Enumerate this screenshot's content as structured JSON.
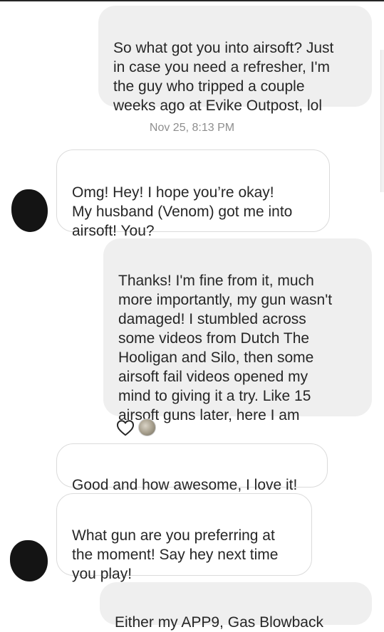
{
  "conversation": {
    "messages": [
      {
        "sender": "me",
        "text": "So what got you into airsoft? Just\nin case you need a refresher, I'm\nthe guy who tripped a couple\nweeks ago at Evike Outpost, lol"
      },
      {
        "sender": "them",
        "text": "Omg! Hey! I hope you’re okay!\nMy husband (Venom) got me into\nairsoft! You?"
      },
      {
        "sender": "me",
        "text": "Thanks! I'm fine from it, much\nmore importantly, my gun wasn't\ndamaged! I stumbled across\nsome videos from Dutch The\nHooligan and Silo, then some\nairsoft fail videos opened my\nmind to giving it a try. Like 15\nairsoft guns later, here I am"
      },
      {
        "sender": "them",
        "text": "Good and how awesome, I love it!"
      },
      {
        "sender": "them",
        "text": "What gun are you preferring at\nthe moment! Say hey next time\nyou play!"
      },
      {
        "sender": "me",
        "text": "Either my APP9, Gas Blowback"
      }
    ],
    "timestamp": "Nov 25, 8:13 PM",
    "reaction": {
      "icon": "heart-outline-icon",
      "reactor": "reactor-avatar"
    }
  },
  "colors": {
    "outgoing_bubble": "#efefef",
    "incoming_border": "#dbdbdb",
    "timestamp": "#8e8e8e",
    "text": "#262626"
  }
}
